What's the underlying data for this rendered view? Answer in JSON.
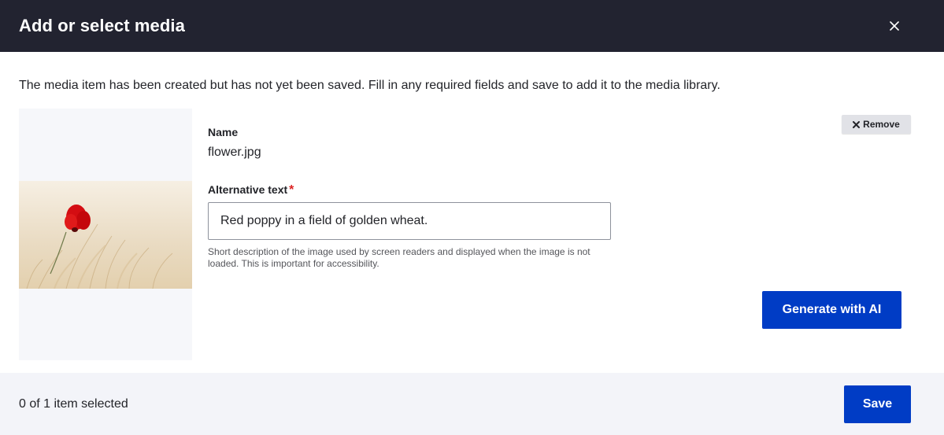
{
  "dialog": {
    "title": "Add or select media",
    "close_icon": "close-icon"
  },
  "notice": "The media item has been created but has not yet been saved. Fill in any required fields and save to add it to the media library.",
  "media": {
    "thumbnail_icon": "image-thumbnail",
    "remove_label": "Remove",
    "name_label": "Name",
    "name_value": "flower.jpg",
    "alt_label": "Alternative text",
    "alt_required_marker": "*",
    "alt_value": "Red poppy in a field of golden wheat.",
    "alt_help": "Short description of the image used by screen readers and displayed when the image is not loaded. This is important for accessibility.",
    "generate_label": "Generate with AI"
  },
  "footer": {
    "selection_count": "0 of 1 item selected",
    "save_label": "Save"
  },
  "colors": {
    "header_bg": "#222330",
    "primary_button": "#003cc5",
    "required": "#dc2323",
    "footer_bg": "#f3f4f9"
  }
}
